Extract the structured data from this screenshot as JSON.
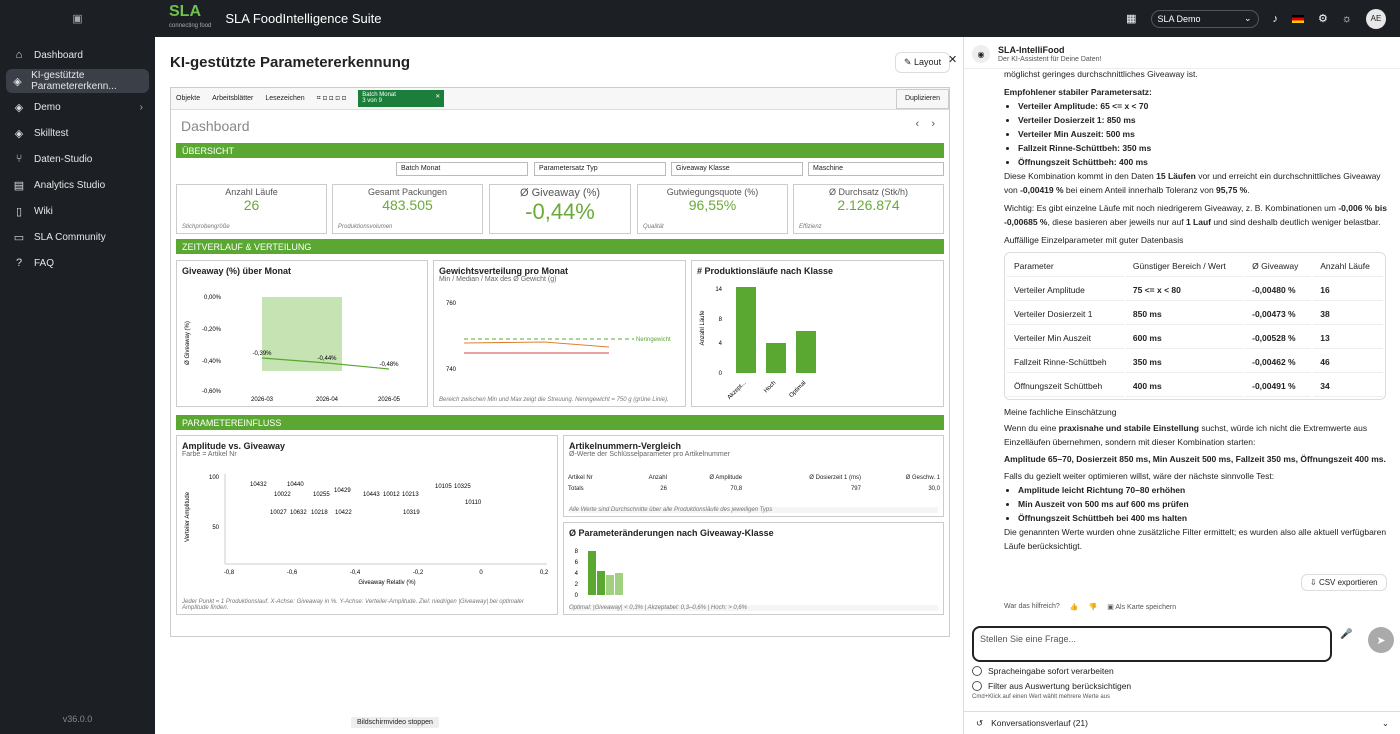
{
  "sidebar": {
    "items": [
      {
        "label": "Dashboard"
      },
      {
        "label": "KI-gestützte Parametererkenn..."
      },
      {
        "label": "Demo"
      },
      {
        "label": "Skilltest"
      },
      {
        "label": "Daten-Studio"
      },
      {
        "label": "Analytics Studio"
      },
      {
        "label": "Wiki"
      },
      {
        "label": "SLA Community"
      },
      {
        "label": "FAQ"
      }
    ],
    "version": "v36.0.0"
  },
  "topbar": {
    "logo": "SLA",
    "logo_sub": "connecting food",
    "app_title": "SLA FoodIntelligence Suite",
    "env": "SLA Demo",
    "avatar": "AE"
  },
  "main": {
    "title": "KI-gestützte Parametererkennung",
    "layout_btn": "Layout",
    "stop": "Bildschirmvideo stoppen"
  },
  "toolbar": {
    "items": [
      "Objekte",
      "Arbeitsblätter",
      "Lesezeichen"
    ],
    "batch": "Batch Monat",
    "batch_sub": "3 von 9",
    "duplicate": "Duplizieren"
  },
  "dashboard": {
    "title": "Dashboard",
    "sections": [
      "ÜBERSICHT",
      "ZEITVERLAUF & VERTEILUNG",
      "PARAMETEREINFLUSS"
    ],
    "filters": [
      "Batch Monat",
      "Parametersatz Typ",
      "Giveaway Klasse",
      "Maschine"
    ],
    "kpis": [
      {
        "title": "Anzahl Läufe",
        "value": "26",
        "sub": "Stichprobengröße"
      },
      {
        "title": "Gesamt Packungen",
        "value": "483.505",
        "sub": "Produktionsvolumen"
      },
      {
        "title": "Ø Giveaway (%)",
        "value": "-0,44%",
        "sub": ""
      },
      {
        "title": "Gutwiegungsquote (%)",
        "value": "96,55%",
        "sub": "Qualität"
      },
      {
        "title": "Ø Durchsatz (Stk/h)",
        "value": "2.126.874",
        "sub": "Effizienz"
      }
    ],
    "c1": {
      "title": "Giveaway (%) über Monat",
      "ylabel": "Ø Giveaway (%)",
      "yticks": [
        "0,00%",
        "-0,20%",
        "-0,40%",
        "-0,60%"
      ],
      "x": [
        "2026-03",
        "2026-04",
        "2026-05"
      ],
      "labels": [
        "-0,39%",
        "-0,44%",
        "-0,48%"
      ]
    },
    "c2": {
      "title": "Gewichtsverteilung pro Monat",
      "sub": "Min / Median / Max des Ø Gewicht (g)",
      "y": [
        "760",
        "740"
      ],
      "ref": "Nenngewicht",
      "foot": "Bereich zwischen Min und Max zeigt die Streuung. Nenngewicht = 750 g (grüne Linie)."
    },
    "c3": {
      "title": "# Produktionsläufe nach Klasse",
      "ylabel": "Anzahl Läufe",
      "yticks": [
        "14",
        "8",
        "4",
        "0"
      ],
      "cats": [
        "Akzept...",
        "Hoch",
        "Optimal"
      ]
    },
    "c4": {
      "title": "Amplitude vs. Giveaway",
      "sub": "Farbe = Artikel Nr",
      "ylabel": "Verteiler Amplitude",
      "xlabel": "Giveaway Relativ (%)",
      "yticks": [
        "100",
        "50"
      ],
      "xticks": [
        "-0,8",
        "-0,6",
        "-0,4",
        "-0,2",
        "0",
        "0,2"
      ],
      "pts": [
        "10432",
        "10440",
        "10022",
        "10255",
        "10429",
        "10443",
        "10012",
        "10213",
        "10105",
        "10325",
        "10027",
        "10632",
        "10218",
        "10422",
        "10319",
        "10110"
      ],
      "foot": "Jeder Punkt = 1 Produktionslauf. X-Achse: Giveaway in %. Y-Achse: Verteiler-Amplitude. Ziel: niedrigen |Giveaway| bei optimaler Amplitude finden."
    },
    "c5": {
      "title": "Artikelnummern-Vergleich",
      "sub": "Ø-Werte der Schlüsselparameter pro Artikelnummer",
      "cols": [
        "Artikel Nr",
        "Anzahl",
        "Ø Amplitude",
        "Ø Dosierzeit 1 (ms)",
        "Ø Geschw. 1"
      ],
      "row": [
        "Totals",
        "26",
        "70,8",
        "797",
        "30,0"
      ],
      "foot": "Alle Werte sind Durchschnitte über alle Produktionsläufe des jeweiligen Typs"
    },
    "c6": {
      "title": "Ø Parameteränderungen nach Giveaway-Klasse",
      "yticks": [
        "8",
        "6",
        "4",
        "2",
        "0"
      ],
      "foot": "Optimal: |Giveaway| < 0,3% | Akzeptabel: 0,3–0,6% | Hoch: > 0,6%"
    }
  },
  "chat": {
    "name": "SLA-IntelliFood",
    "sub": "Der KI-Assistent für Deine Daten!",
    "intro": "möglichst geringes durchschnittliches Giveaway ist.",
    "rec_title": "Empfohlener stabiler Parametersatz:",
    "rec": [
      "Verteiler Amplitude: 65 <= x < 70",
      "Verteiler Dosierzeit 1: 850 ms",
      "Verteiler Min Auszeit: 500 ms",
      "Fallzeit Rinne-Schüttbeh: 350 ms",
      "Öffnungszeit Schüttbeh: 400 ms"
    ],
    "p1a": "Diese Kombination kommt in den Daten ",
    "p1b": "15 Läufen",
    "p1c": " vor und erreicht ein durchschnittliches Giveaway von ",
    "p1d": "-0,00419 %",
    "p1e": " bei einem Anteil innerhalb Toleranz von ",
    "p1f": "95,75 %",
    "p1g": ".",
    "p2a": "Wichtig: Es gibt einzelne Läufe mit noch niedrigerem Giveaway, z. B. Kombinationen um ",
    "p2b": "-0,006 % bis -0,00685 %",
    "p2c": ", diese basieren aber jeweils nur auf ",
    "p2d": "1 Lauf",
    "p2e": " und sind deshalb deutlich weniger belastbar.",
    "p3": "Auffällige Einzelparameter mit guter Datenbasis",
    "th": [
      "Parameter",
      "Günstiger Bereich / Wert",
      "Ø Giveaway",
      "Anzahl Läufe"
    ],
    "rows": [
      [
        "Verteiler Amplitude",
        "75 <= x < 80",
        "-0,00480 %",
        "16"
      ],
      [
        "Verteiler Dosierzeit 1",
        "850 ms",
        "-0,00473 %",
        "38"
      ],
      [
        "Verteiler Min Auszeit",
        "600 ms",
        "-0,00528 %",
        "13"
      ],
      [
        "Fallzeit Rinne-Schüttbeh",
        "350 ms",
        "-0,00462 %",
        "46"
      ],
      [
        "Öffnungszeit Schüttbeh",
        "400 ms",
        "-0,00491 %",
        "34"
      ]
    ],
    "p4": "Meine fachliche Einschätzung",
    "p5a": "Wenn du eine ",
    "p5b": "praxisnahe und stabile Einstellung",
    "p5c": " suchst, würde ich nicht die Extremwerte aus Einzelläufen übernehmen, sondern mit dieser Kombination starten:",
    "p6": "Amplitude 65–70, Dosierzeit 850 ms, Min Auszeit 500 ms, Fallzeit 350 ms, Öffnungszeit 400 ms.",
    "p7": "Falls du gezielt weiter optimieren willst, wäre der nächste sinnvolle Test:",
    "test": [
      "Amplitude leicht Richtung 70–80 erhöhen",
      "Min Auszeit von 500 ms auf 600 ms prüfen",
      "Öffnungszeit Schüttbeh bei 400 ms halten"
    ],
    "p8": "Die genannten Werte wurden ohne zusätzliche Filter ermittelt; es wurden also alle aktuell verfügbaren Läufe berücksichtigt.",
    "csv": "CSV exportieren",
    "helpful": "War das hilfreich?",
    "save": "Als Karte speichern",
    "placeholder": "Stellen Sie eine Frage...",
    "opt1": "Spracheingabe sofort verarbeiten",
    "opt2": "Filter aus Auswertung berücksichtigen",
    "hint": "Cmd+Klick auf einen Wert wählt mehrere Werte aus",
    "conv": "Konversationsverlauf (21)"
  }
}
